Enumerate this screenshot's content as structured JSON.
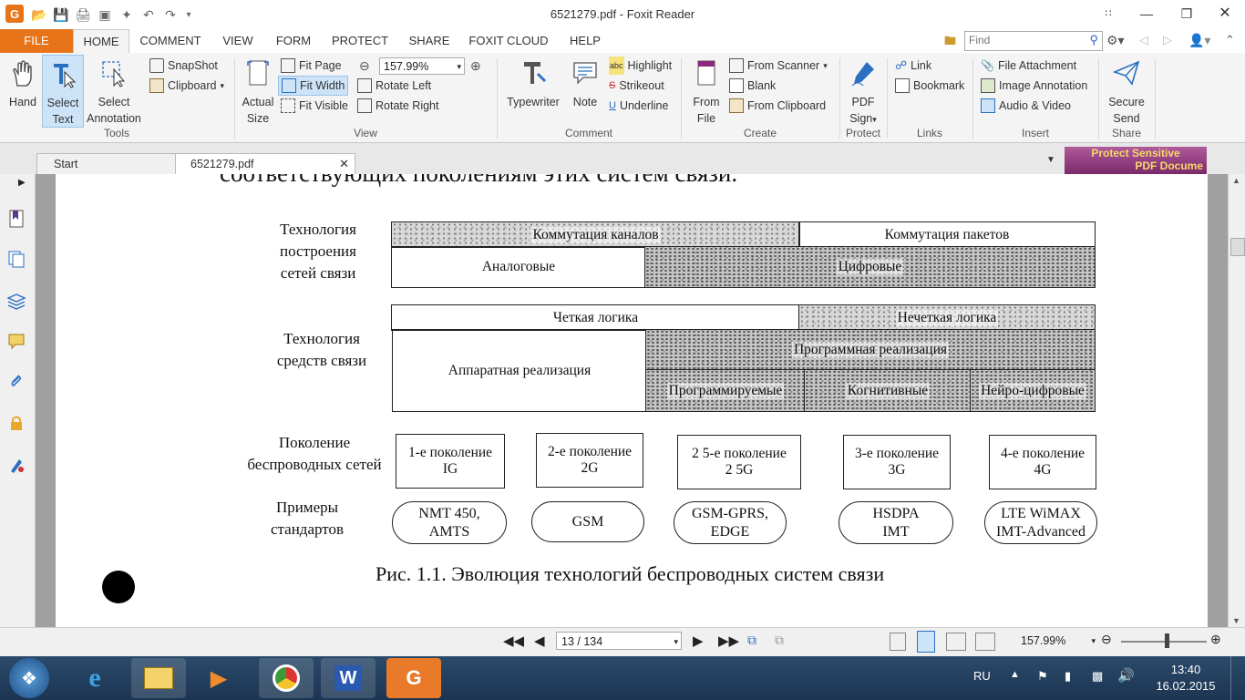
{
  "window": {
    "title": "6521279.pdf - Foxit Reader"
  },
  "menu_tabs": [
    "FILE",
    "HOME",
    "COMMENT",
    "VIEW",
    "FORM",
    "PROTECT",
    "SHARE",
    "FOXIT CLOUD",
    "HELP"
  ],
  "search": {
    "placeholder": "Find"
  },
  "ribbon": {
    "tools": {
      "hand": "Hand",
      "select_text_1": "Select",
      "select_text_2": "Text",
      "select_annot_1": "Select",
      "select_annot_2": "Annotation",
      "snapshot": "SnapShot",
      "clipboard": "Clipboard",
      "label": "Tools"
    },
    "view": {
      "actual_1": "Actual",
      "actual_2": "Size",
      "fit_page": "Fit Page",
      "fit_width": "Fit Width",
      "fit_visible": "Fit Visible",
      "zoom": "157.99%",
      "rotate_left": "Rotate Left",
      "rotate_right": "Rotate Right",
      "label": "View"
    },
    "comment": {
      "typewriter": "Typewriter",
      "note": "Note",
      "highlight": "Highlight",
      "strikeout": "Strikeout",
      "underline": "Underline",
      "label": "Comment"
    },
    "create": {
      "from_file_1": "From",
      "from_file_2": "File",
      "from_scanner": "From Scanner",
      "blank": "Blank",
      "from_clipboard": "From Clipboard",
      "label": "Create"
    },
    "protect": {
      "pdf_sign_1": "PDF",
      "pdf_sign_2": "Sign",
      "label": "Protect"
    },
    "links": {
      "link": "Link",
      "bookmark": "Bookmark",
      "label": "Links"
    },
    "insert": {
      "file_attachment": "File Attachment",
      "image_annotation": "Image Annotation",
      "audio_video": "Audio & Video",
      "label": "Insert"
    },
    "share": {
      "secure_1": "Secure",
      "secure_2": "Send",
      "label": "Share"
    }
  },
  "doc_tabs": {
    "start": "Start",
    "file": "6521279.pdf",
    "banner_1": "Protect Sensitive",
    "banner_2": "PDF Docume"
  },
  "document": {
    "top_line": "соответствующих поколениям этих систем связи.",
    "row1_label": [
      "Технология",
      "построения",
      "сетей связи"
    ],
    "circuit": "Коммутация каналов",
    "packet": "Коммутация пакетов",
    "analog": "Аналоговые",
    "digital": "Цифровые",
    "row2_label": [
      "Технология",
      "средств связи"
    ],
    "crisp": "Четкая логика",
    "fuzzy": "Нечеткая логика",
    "hardware": "Аппаратная реализация",
    "software": "Программная реализация",
    "programmable": "Программируемые",
    "cognitive": "Когнитивные",
    "neuro": "Нейро-цифровые",
    "row3_label": [
      "Поколение",
      "беспроводных сетей"
    ],
    "generations": [
      [
        "1-е поколение",
        "IG"
      ],
      [
        "2-е поколение",
        "2G"
      ],
      [
        "2 5-е поколение",
        "2 5G"
      ],
      [
        "3-е поколение",
        "3G"
      ],
      [
        "4-е поколение",
        "4G"
      ]
    ],
    "row4_label": [
      "Примеры",
      "стандартов"
    ],
    "standards": [
      [
        "NMT 450,",
        "AMTS"
      ],
      [
        "GSM",
        ""
      ],
      [
        "GSM-GPRS,",
        "EDGE"
      ],
      [
        "HSDPA",
        "IMT"
      ],
      [
        "LTE WiMAX",
        "IMT-Advanced"
      ]
    ],
    "caption": "Рис. 1.1. Эволюция технологий беспроводных систем связи"
  },
  "statusbar": {
    "page": "13 / 134",
    "zoom": "157.99%"
  },
  "taskbar": {
    "lang": "RU",
    "time": "13:40",
    "date": "16.02.2015"
  }
}
